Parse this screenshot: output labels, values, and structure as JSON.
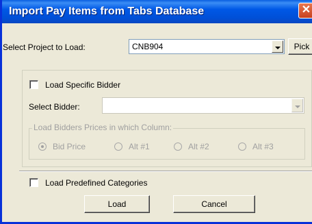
{
  "window": {
    "title": "Import Pay Items from Tabs Database",
    "close_glyph": "✕"
  },
  "project": {
    "label": "Select Project to Load:",
    "value": "CNB904",
    "pick_label": "Pick"
  },
  "bidder": {
    "load_specific_label": "Load Specific Bidder",
    "select_label": "Select Bidder:",
    "select_value": "",
    "prices_group_label": "Load Bidders Prices in which Column:",
    "options": [
      "Bid Price",
      "Alt #1",
      "Alt #2",
      "Alt #3"
    ],
    "selected": "Bid Price"
  },
  "categories": {
    "label": "Load Predefined Categories"
  },
  "buttons": {
    "load": "Load",
    "cancel": "Cancel"
  },
  "colors": {
    "titlebar": "#0058e6",
    "close": "#d9542b",
    "dialog_bg": "#ece9d8"
  }
}
